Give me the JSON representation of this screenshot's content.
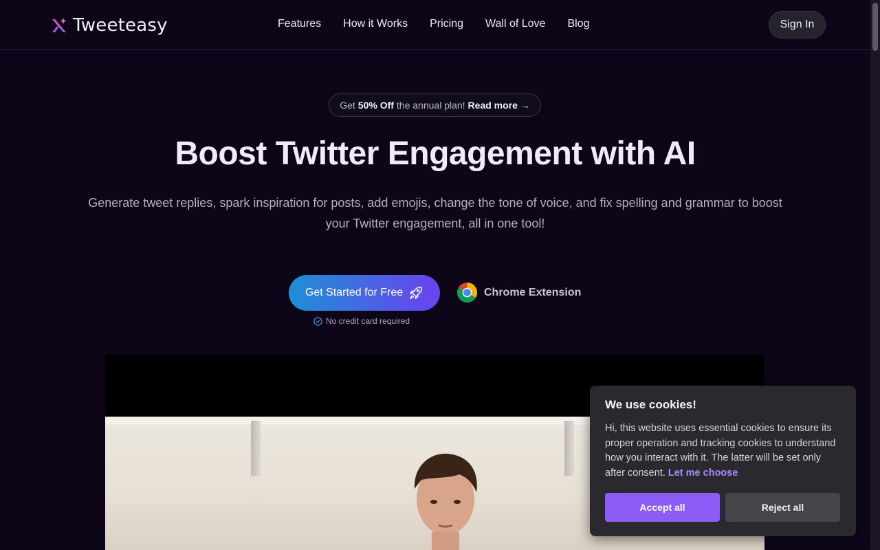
{
  "brand": {
    "name": "Tweeteasy"
  },
  "nav": {
    "links": [
      "Features",
      "How it Works",
      "Pricing",
      "Wall of Love",
      "Blog"
    ],
    "signin_label": "Sign In"
  },
  "promo": {
    "prefix": "Get",
    "highlight": "50% Off",
    "middle": "the annual plan!",
    "link": "Read more →"
  },
  "hero": {
    "title": "Boost Twitter Engagement with AI",
    "subtitle": "Generate tweet replies, spark inspiration for posts, add emojis, change the tone of voice, and fix spelling and grammar to boost your Twitter engagement, all in one tool!",
    "cta_label": "Get Started for Free",
    "chrome_label": "Chrome Extension",
    "no_card": "No credit card required"
  },
  "cookie": {
    "title": "We use cookies!",
    "text": "Hi, this website uses essential cookies to ensure its proper operation and tracking cookies to understand how you interact with it. The latter will be set only after consent.",
    "link": "Let me choose",
    "accept_label": "Accept all",
    "reject_label": "Reject all"
  },
  "colors": {
    "background": "#0c0618",
    "accent": "#8b5cf6",
    "cta_gradient_start": "#1e8fd4",
    "cta_gradient_end": "#6b41f0"
  }
}
